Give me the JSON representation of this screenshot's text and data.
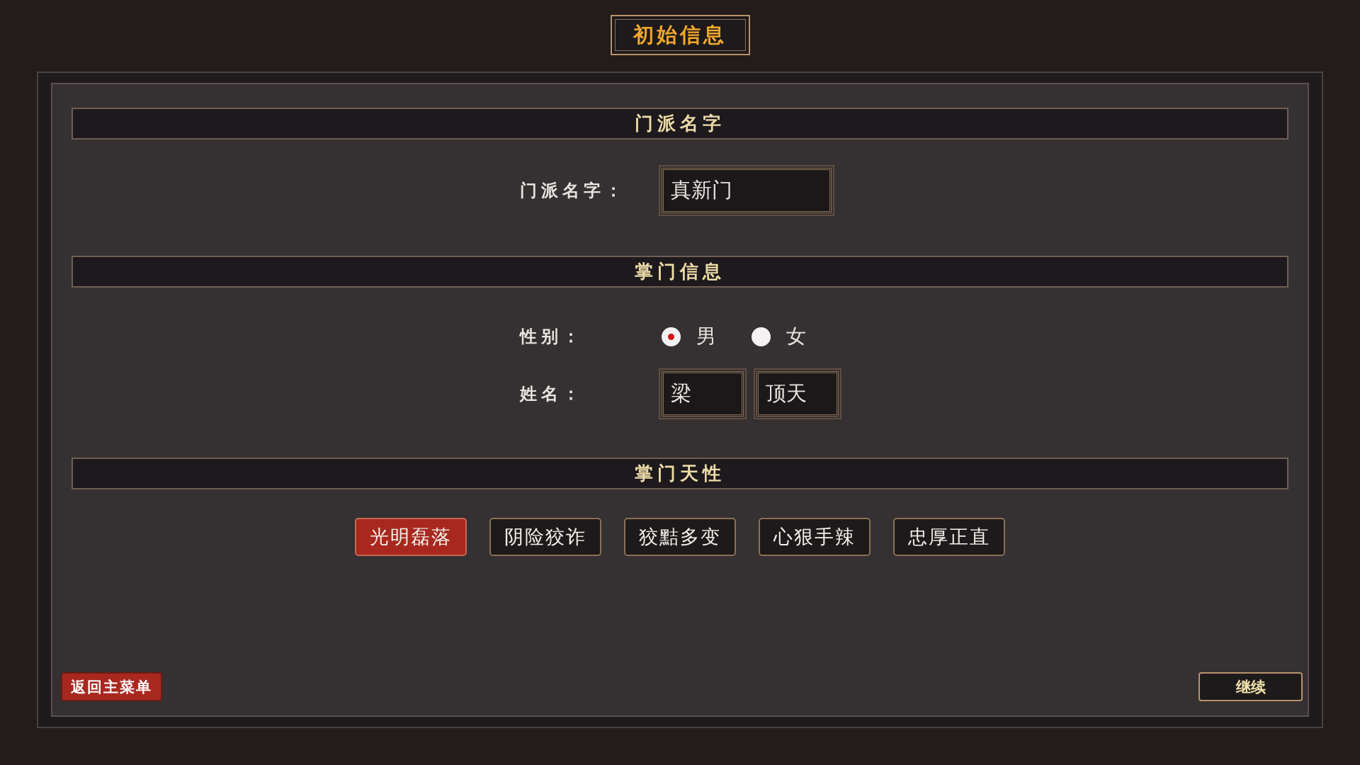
{
  "window": {
    "title": "初始信息"
  },
  "sections": [
    {
      "kind": "sect_name",
      "title": "门派名字",
      "label": "门派名字：",
      "value": "真新门"
    },
    {
      "kind": "leader",
      "title": "掌门信息",
      "gender_label": "性别：",
      "genders": [
        {
          "label": "男",
          "selected": true
        },
        {
          "label": "女",
          "selected": false
        }
      ],
      "name_label": "姓名：",
      "surname": "梁",
      "given_name": "顶天"
    },
    {
      "kind": "traits",
      "title": "掌门天性",
      "traits": [
        {
          "label": "光明磊落",
          "selected": true
        },
        {
          "label": "阴险狡诈",
          "selected": false
        },
        {
          "label": "狡黠多变",
          "selected": false
        },
        {
          "label": "心狠手辣",
          "selected": false
        },
        {
          "label": "忠厚正直",
          "selected": false
        }
      ]
    }
  ],
  "buttons": {
    "back": "返回主菜单",
    "continue": "继续"
  }
}
